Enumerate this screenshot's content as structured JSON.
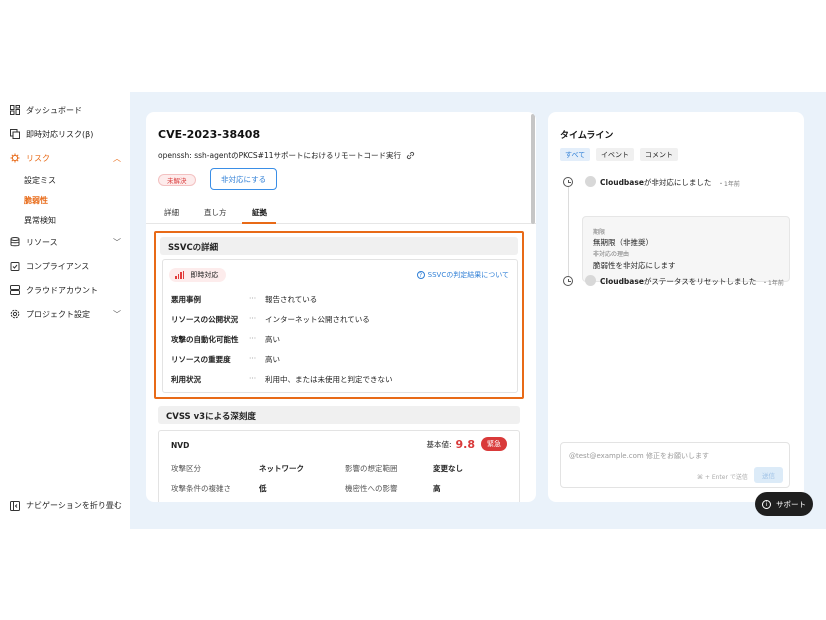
{
  "sidebar": {
    "items": [
      {
        "label": "ダッシュボード",
        "icon": "dashboard-icon"
      },
      {
        "label": "即時対応リスク(β)",
        "icon": "copy-icon"
      },
      {
        "label": "リスク",
        "icon": "virus-icon"
      },
      {
        "label": "リソース",
        "icon": "database-icon"
      },
      {
        "label": "コンプライアンス",
        "icon": "clipboard-check-icon"
      },
      {
        "label": "クラウドアカウント",
        "icon": "server-icon"
      },
      {
        "label": "プロジェクト設定",
        "icon": "gear-icon"
      }
    ],
    "risk_sub": [
      "設定ミス",
      "脆弱性",
      "異常検知"
    ],
    "collapse_label": "ナビゲーションを折り畳む"
  },
  "detail": {
    "cve_id": "CVE-2023-38408",
    "description": "openssh: ssh-agentのPKCS#11サポートにおけるリモートコード実行",
    "status_badge": "未解決",
    "action_button": "非対応にする",
    "tabs": [
      "詳細",
      "直し方",
      "証拠"
    ],
    "active_tab": "証拠"
  },
  "ssvc": {
    "heading": "SSVCの詳細",
    "decision": "即時対応",
    "help_link": "SSVCの判定結果について",
    "separator": "···",
    "rows": [
      {
        "key": "悪用事例",
        "value": "報告されている"
      },
      {
        "key": "リソースの公開状況",
        "value": "インターネット公開されている"
      },
      {
        "key": "攻撃の自動化可能性",
        "value": "高い"
      },
      {
        "key": "リソースの重要度",
        "value": "高い"
      },
      {
        "key": "利用状況",
        "value": "利用中、または未使用と判定できない"
      }
    ]
  },
  "cvss": {
    "heading": "CVSS v3による深刻度",
    "source": "NVD",
    "score_label": "基本値:",
    "score": "9.8",
    "severity": "緊急",
    "metrics": [
      {
        "key": "攻撃区分",
        "value": "ネットワーク"
      },
      {
        "key": "影響の想定範囲",
        "value": "変更なし"
      },
      {
        "key": "攻撃条件の複雑さ",
        "value": "低"
      },
      {
        "key": "機密性への影響",
        "value": "高"
      }
    ]
  },
  "timeline": {
    "title": "タイムライン",
    "filters": [
      "すべて",
      "イベント",
      "コメント"
    ],
    "events": [
      {
        "actor": "Cloudbase",
        "text": "が非対応にしました",
        "time": "・1年前"
      },
      {
        "actor": "Cloudbase",
        "text": "がステータスをリセットしました",
        "time": "・1年前"
      }
    ],
    "detail": {
      "period_label": "期限",
      "period_value": "無期限（非推奨）",
      "reason_label": "非対応の理由",
      "reason_value": "脆弱性を非対応にします"
    },
    "comment_placeholder": "@test@example.com 修正をお願いします",
    "comment_hint": "⌘ + Enter で送信",
    "send_label": "送信"
  },
  "support_label": "サポート",
  "colors": {
    "accent": "#e86a17",
    "link": "#2f7fd6",
    "danger": "#d93a3a",
    "bg": "#eaf2fa"
  }
}
